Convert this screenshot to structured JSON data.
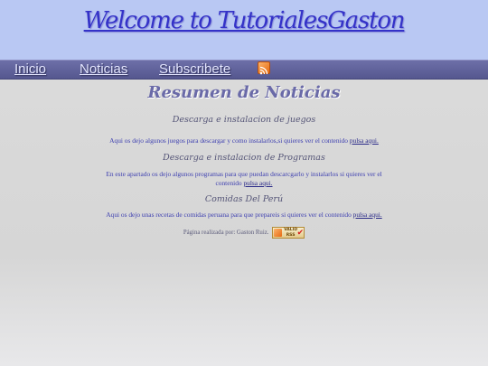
{
  "header": {
    "title": "Welcome to TutorialesGaston"
  },
  "nav": {
    "items": [
      "Inicio",
      "Noticias",
      "Subscribete"
    ]
  },
  "main": {
    "heading": "Resumen de Noticias",
    "sections": [
      {
        "title": "Descarga e instalacion de juegos",
        "text": "Aqui os dejo algunos juegos para descargar y como instalarlos,si quieres ver el contenido ",
        "link": "pulsa aqui."
      },
      {
        "title": "Descarga e instalacion de Programas",
        "text": "En este apartado os dejo algunos programas para que puedan descarcgarlo y instalarlos si quieres ver el contenido ",
        "link": "pulsa aqui."
      },
      {
        "title": "Comidas Del Perú",
        "text": "Aqui os dejo unas recetas de comidas peruana para que prepareis si quieres ver el contenido ",
        "link": "pulsa aqui."
      }
    ]
  },
  "footer": {
    "text": "Página realizada por: Gaston Ruiz.",
    "badge_top": "VALID",
    "badge_bottom": "RSS"
  },
  "colors": {
    "header_bg": "#b9c8f3",
    "nav_bg": "#5e609a",
    "title": "#3432c8",
    "link": "#3d3fb0"
  },
  "icons": {
    "feed": "rss-icon",
    "badge": "valid-rss-badge"
  }
}
